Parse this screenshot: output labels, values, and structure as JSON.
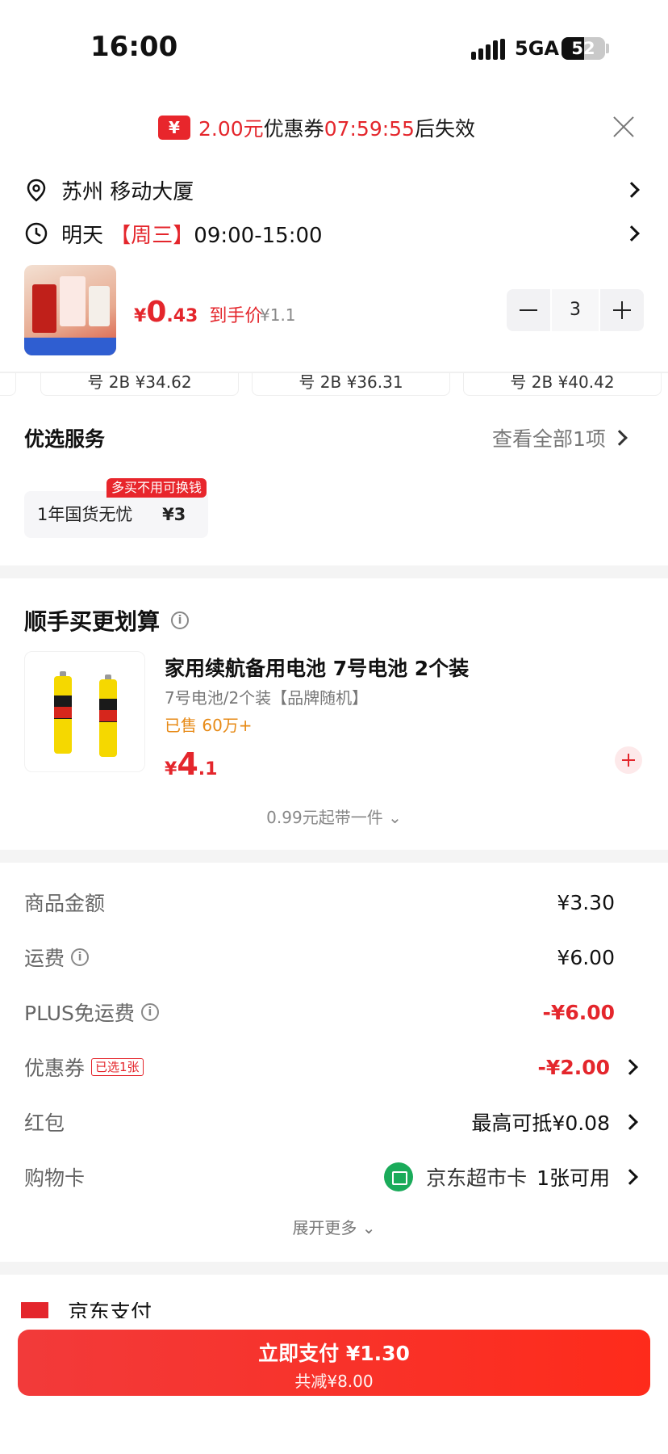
{
  "status_bar": {
    "time": "16:00",
    "network": "5GA",
    "battery": "52"
  },
  "coupon_banner": {
    "amount": "2.00元",
    "label": "优惠券",
    "countdown": "07:59:55",
    "suffix": "后失效"
  },
  "address": {
    "text": "苏州  移动大厦"
  },
  "delivery": {
    "day": "明天",
    "weekday": "【周三】",
    "time_range": "09:00-15:00"
  },
  "product": {
    "price_symbol": "¥",
    "price_int": "0",
    "price_dec": ".43",
    "price_label": "到手价",
    "original_price": "¥1.1",
    "quantity": "3"
  },
  "partial_cards": [
    "号 2B  ¥34.62",
    "号 2B  ¥36.31",
    "号 2B  ¥40.42"
  ],
  "service": {
    "title": "优选服务",
    "view_all": "查看全部1项",
    "badge": "多买不用可换钱",
    "item_name": "1年国货无忧",
    "item_price": "¥3"
  },
  "addon": {
    "title": "顺手买更划算",
    "name": "家用续航备用电池 7号电池 2个装",
    "spec": "7号电池/2个装【品牌随机】",
    "sold": "已售 60万+",
    "price_symbol": "¥",
    "price_int": "4",
    "price_dec": ".1",
    "more": "0.99元起带一件"
  },
  "costs": {
    "goods_label": "商品金额",
    "goods_value": "¥3.30",
    "shipping_label": "运费",
    "shipping_value": "¥6.00",
    "plus_label": "PLUS免运费",
    "plus_value": "-¥6.00",
    "coupon_label": "优惠券",
    "coupon_tag": "已选1张",
    "coupon_value": "-¥2.00",
    "redpack_label": "红包",
    "redpack_value": "最高可抵¥0.08",
    "giftcard_label": "购物卡",
    "giftcard_name": "京东超市卡",
    "giftcard_value": "1张可用",
    "expand": "展开更多"
  },
  "payment": {
    "method": "京东支付"
  },
  "footer": {
    "pay_label": "立即支付 ¥1.30",
    "saving": "共减¥8.00"
  },
  "colors": {
    "accent_red": "#e4262c",
    "sold_orange": "#e78a16",
    "card_green": "#1aab5a"
  }
}
